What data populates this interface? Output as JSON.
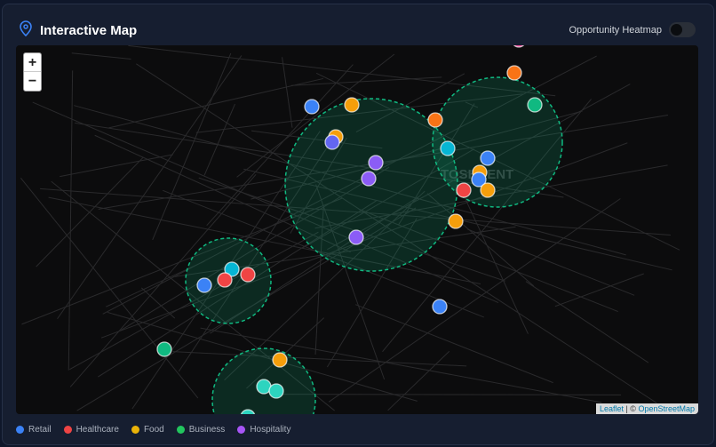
{
  "header": {
    "title": "Interactive Map",
    "heatmap_label": "Opportunity Heatmap",
    "heatmap_on": false
  },
  "map": {
    "zoom_in": "+",
    "zoom_out": "−",
    "city_label": "TOSHKENT",
    "attribution_leaflet": "Leaflet",
    "attribution_sep": " | © ",
    "attribution_osm": "OpenStreetMap"
  },
  "legend": [
    {
      "label": "Retail",
      "color": "#3b82f6"
    },
    {
      "label": "Healthcare",
      "color": "#ef4444"
    },
    {
      "label": "Food",
      "color": "#eab308"
    },
    {
      "label": "Business",
      "color": "#22c55e"
    },
    {
      "label": "Hospitality",
      "color": "#a855f7"
    }
  ]
}
